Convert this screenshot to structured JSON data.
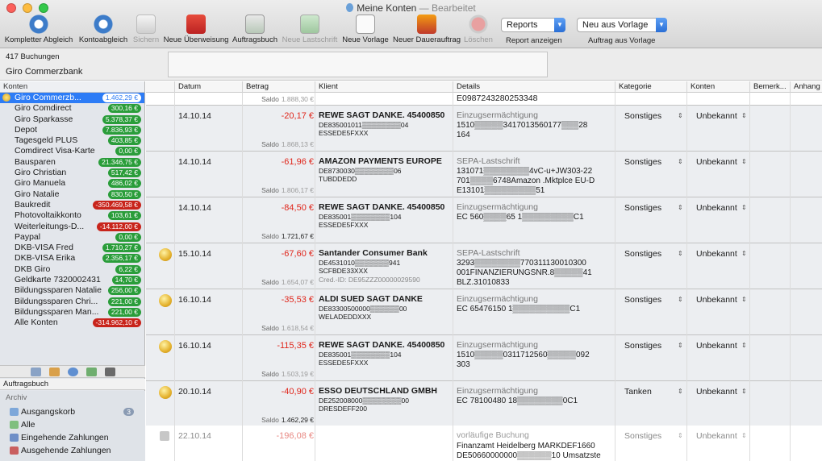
{
  "window": {
    "title": "Meine Konten",
    "subtitle": "— Bearbeitet"
  },
  "toolbar": {
    "buttons": [
      {
        "label": "Kompletter Abgleich",
        "icon": "sync-all-icon",
        "enabled": true
      },
      {
        "label": "Kontoabgleich",
        "icon": "sync-icon",
        "enabled": true
      },
      {
        "label": "Sichern",
        "icon": "save-icon",
        "enabled": false
      },
      {
        "label": "Neue Überweisung",
        "icon": "transfer-icon",
        "enabled": true
      },
      {
        "label": "Auftragsbuch",
        "icon": "order-book-icon",
        "enabled": true
      },
      {
        "label": "Neue Lastschrift",
        "icon": "direct-debit-icon",
        "enabled": false
      },
      {
        "label": "Neue Vorlage",
        "icon": "template-icon",
        "enabled": true
      },
      {
        "label": "Neuer Dauerauftrag",
        "icon": "standing-order-icon",
        "enabled": true
      },
      {
        "label": "Löschen",
        "icon": "delete-icon",
        "enabled": false
      }
    ],
    "reports_select": "Reports",
    "reports_caption": "Report anzeigen",
    "template_select": "Neu aus Vorlage",
    "template_caption": "Auftrag aus Vorlage"
  },
  "header": {
    "bookings_count": "417 Buchungen",
    "account_name": "Giro Commerzbank",
    "search_value": ""
  },
  "sidebar": {
    "heading": "Konten",
    "accounts": [
      {
        "name": "Giro Commerzb...",
        "balance": "1.462,29 €",
        "negative": false,
        "selected": true
      },
      {
        "name": "Giro Comdirect",
        "balance": "300,16 €",
        "negative": false
      },
      {
        "name": "Giro Sparkasse",
        "balance": "5.378,37 €",
        "negative": false
      },
      {
        "name": "Depot",
        "balance": "7.836,93 €",
        "negative": false
      },
      {
        "name": "Tagesgeld PLUS",
        "balance": "403,85 €",
        "negative": false
      },
      {
        "name": "Comdirect Visa-Karte",
        "balance": "0,00 €",
        "negative": false
      },
      {
        "name": "Bausparen",
        "balance": "21.346,75 €",
        "negative": false
      },
      {
        "name": "Giro Christian",
        "balance": "517,42 €",
        "negative": false
      },
      {
        "name": "Giro Manuela",
        "balance": "486,02 €",
        "negative": false
      },
      {
        "name": "Giro Natalie",
        "balance": "830,50 €",
        "negative": false
      },
      {
        "name": "Baukredit",
        "balance": "-350.469,58 €",
        "negative": true
      },
      {
        "name": "Photovoltaikkonto",
        "balance": "103,61 €",
        "negative": false
      },
      {
        "name": "Weiterleitungs-D...",
        "balance": "-14.112,00 €",
        "negative": true
      },
      {
        "name": "Paypal",
        "balance": "0,00 €",
        "negative": false
      },
      {
        "name": "DKB-VISA Fred",
        "balance": "1.710,27 €",
        "negative": false
      },
      {
        "name": "DKB-VISA Erika",
        "balance": "2.356,17 €",
        "negative": false
      },
      {
        "name": "DKB Giro",
        "balance": "6,22 €",
        "negative": false
      },
      {
        "name": "Geldkarte 7320002431",
        "balance": "14,70 €",
        "negative": false
      },
      {
        "name": "Bildungssparen Natalie",
        "balance": "256,00 €",
        "negative": false
      },
      {
        "name": "Bildungssparen Chri...",
        "balance": "221,00 €",
        "negative": false
      },
      {
        "name": "Bildungssparen Man...",
        "balance": "221,00 €",
        "negative": false
      },
      {
        "name": "Alle Konten",
        "balance": "-314.962,10 €",
        "negative": true
      }
    ],
    "orderbook_heading": "Auftragsbuch",
    "archive_title": "Archiv",
    "archive_items": [
      {
        "label": "Ausgangskorb",
        "count": "3"
      },
      {
        "label": "Alle",
        "count": ""
      },
      {
        "label": "Eingehende Zahlungen",
        "count": ""
      },
      {
        "label": "Ausgehende Zahlungen",
        "count": ""
      }
    ]
  },
  "table": {
    "columns": [
      "Datum",
      "Betrag",
      "Klient",
      "Details",
      "Kategorie",
      "Konten",
      "Bemerk...",
      "Anhang"
    ],
    "top_row": {
      "saldo_label": "Saldo",
      "saldo": "1.888,30 €",
      "details": "E0987243280253348"
    },
    "rows": [
      {
        "date": "14.10.14",
        "amount": "-20,17 €",
        "saldo": "1.868,13 €",
        "saldo_dark": false,
        "client": "REWE SAGT DANKE. 45400850",
        "client_l2": "DE835001011▒▒▒▒▒▒▒▒04",
        "client_l3": "ESSEDE5FXXX",
        "client_l4": "",
        "det_type": "Einzugsermächtigung",
        "det_l1": "1510▒▒▒▒▒3417013560177▒▒▒28",
        "det_l2": "164",
        "det_l3": "",
        "category": "Sonstiges",
        "account": "Unbekannt",
        "coin": false,
        "lock": false
      },
      {
        "date": "14.10.14",
        "amount": "-61,96 €",
        "saldo": "1.806,17 €",
        "saldo_dark": false,
        "client": "AMAZON PAYMENTS EUROPE",
        "client_l2": "DE8730030▒▒▒▒▒▒▒▒06",
        "client_l3": "TUBDDEDD",
        "client_l4": "",
        "det_type": "SEPA-Lastschrift",
        "det_l1": "131071▒▒▒▒▒▒▒▒4vC-u+JW303-22",
        "det_l2": "701▒▒▒▒6748Amazon .Mktplce EU-D",
        "det_l3": "E13101▒▒▒▒▒▒▒▒▒51",
        "category": "Sonstiges",
        "account": "Unbekannt",
        "coin": false,
        "lock": false
      },
      {
        "date": "14.10.14",
        "amount": "-84,50 €",
        "saldo": "1.721,67 €",
        "saldo_dark": true,
        "client": "REWE SAGT DANKE. 45400850",
        "client_l2": "DE835001▒▒▒▒▒▒▒▒104",
        "client_l3": "ESSEDE5FXXX",
        "client_l4": "",
        "det_type": "Einzugsermächtigung",
        "det_l1": "EC 560▒▒▒▒65 1▒▒▒▒▒▒▒▒▒C1",
        "det_l2": "",
        "det_l3": "",
        "category": "Sonstiges",
        "account": "Unbekannt",
        "coin": false,
        "lock": false
      },
      {
        "date": "15.10.14",
        "amount": "-67,60 €",
        "saldo": "1.654,07 €",
        "saldo_dark": false,
        "client": "Santander Consumer Bank",
        "client_l2": "DE4531010▒▒▒▒▒▒▒941",
        "client_l3": "SCFBDE33XXX",
        "client_l4": "Cred.-ID: DE95ZZZ00000029590",
        "det_type": "SEPA-Lastschrift",
        "det_l1": "3293▒▒▒▒▒▒▒▒770311130010300",
        "det_l2": "001FINANZIERUNGSNR.8▒▒▒▒▒41",
        "det_l3": "BLZ.31010833",
        "category": "Sonstiges",
        "account": "Unbekannt",
        "coin": true,
        "lock": false
      },
      {
        "date": "16.10.14",
        "amount": "-35,53 €",
        "saldo": "1.618,54 €",
        "saldo_dark": false,
        "client": "ALDI SUED SAGT DANKE",
        "client_l2": "DE83300500000▒▒▒▒▒▒00",
        "client_l3": "WELADEDDXXX",
        "client_l4": "",
        "det_type": "Einzugsermächtigung",
        "det_l1": "EC 65476150 1▒▒▒▒▒▒▒▒▒▒C1",
        "det_l2": "",
        "det_l3": "",
        "category": "Sonstiges",
        "account": "Unbekannt",
        "coin": true,
        "lock": false
      },
      {
        "date": "16.10.14",
        "amount": "-115,35 €",
        "saldo": "1.503,19 €",
        "saldo_dark": false,
        "client": "REWE SAGT DANKE. 45400850",
        "client_l2": "DE835001▒▒▒▒▒▒▒▒104",
        "client_l3": "ESSEDE5FXXX",
        "client_l4": "",
        "det_type": "Einzugsermächtigung",
        "det_l1": "1510▒▒▒▒▒0311712560▒▒▒▒▒092",
        "det_l2": "303",
        "det_l3": "",
        "category": "Sonstiges",
        "account": "Unbekannt",
        "coin": true,
        "lock": false
      },
      {
        "date": "20.10.14",
        "amount": "-40,90 €",
        "saldo": "1.462,29 €",
        "saldo_dark": true,
        "client": "ESSO DEUTSCHLAND GMBH",
        "client_l2": "DE252008000▒▒▒▒▒▒▒▒00",
        "client_l3": "DRESDEFF200",
        "client_l4": "",
        "det_type": "Einzugsermächtigung",
        "det_l1": "EC 78100480 18▒▒▒▒▒▒▒▒0C1",
        "det_l2": "",
        "det_l3": "",
        "category": "Tanken",
        "account": "Unbekannt",
        "coin": true,
        "lock": false
      }
    ],
    "pending_row": {
      "date": "22.10.14",
      "amount": "-196,08 €",
      "det_type": "vorläufige Buchung",
      "det_l1": "Finanzamt Heidelberg MARKDEF1660",
      "det_l2": "DE50660000000▒▒▒▒▒▒10 Umsatzste",
      "category": "Sonstiges",
      "account": "Unbekannt"
    }
  },
  "colors": {
    "accent": "#2d7cf6",
    "positive": "#2a9d3a",
    "negative": "#c8241b",
    "amount_negative": "#e0261b"
  }
}
